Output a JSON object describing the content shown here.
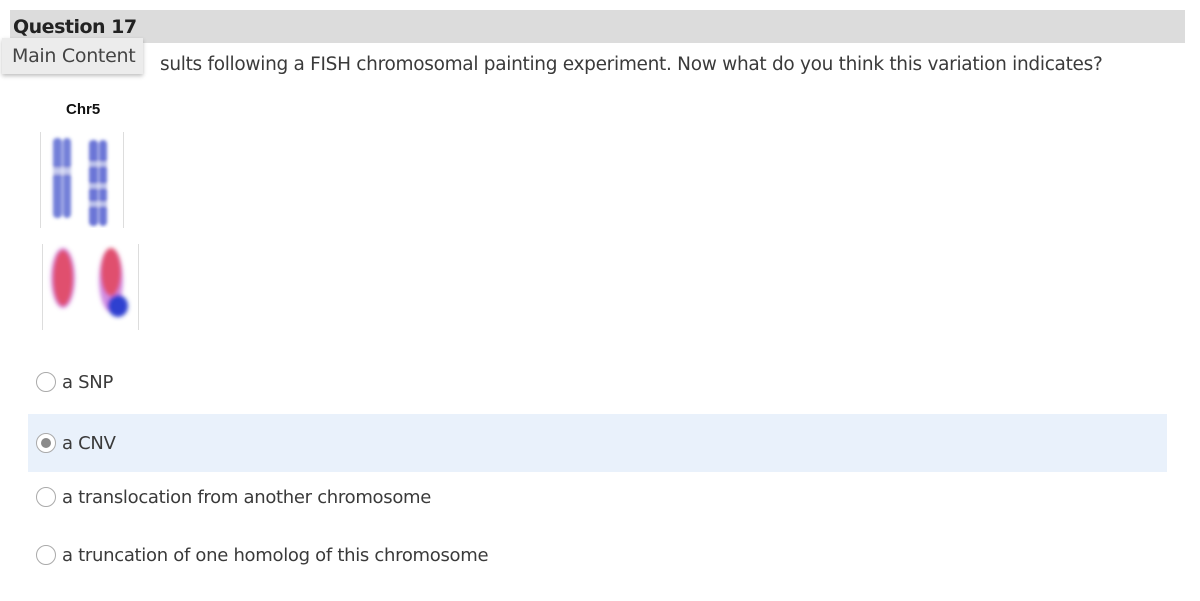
{
  "question": {
    "title": "Question 17",
    "text": "sults following a FISH chromosomal painting experiment. Now what do you think this variation indicates?",
    "figure_label": "Chr5"
  },
  "tooltip": {
    "label": "Main Content"
  },
  "options": [
    {
      "label": "a SNP",
      "selected": false
    },
    {
      "label": "a CNV",
      "selected": true
    },
    {
      "label": "a translocation from another chromosome",
      "selected": false
    },
    {
      "label": "a truncation of one homolog of this chromosome",
      "selected": false
    }
  ],
  "colors": {
    "header": "#dcdcdc",
    "selected_row": "#e9f1fb",
    "paint_red": "#e0506e",
    "stain_blue": "#2f3fd0"
  }
}
